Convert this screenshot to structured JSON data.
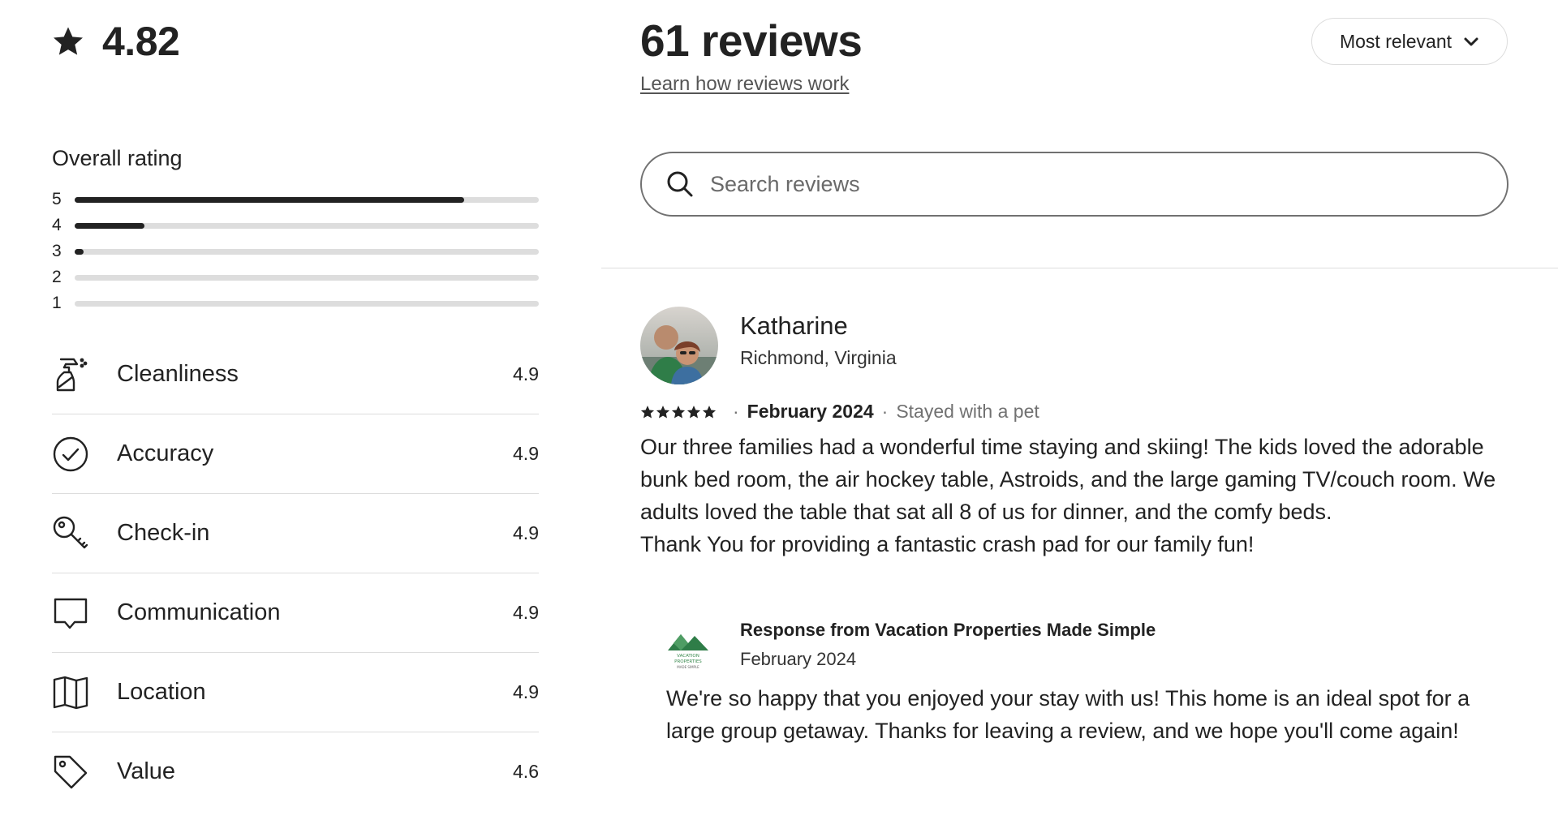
{
  "summary": {
    "overall_score": "4.82",
    "overall_rating_label": "Overall rating",
    "distribution": [
      {
        "label": "5",
        "fraction": 0.84
      },
      {
        "label": "4",
        "fraction": 0.15
      },
      {
        "label": "3",
        "fraction": 0.02
      },
      {
        "label": "2",
        "fraction": 0.0
      },
      {
        "label": "1",
        "fraction": 0.0
      }
    ],
    "categories": [
      {
        "name": "Cleanliness",
        "value": "4.9",
        "icon": "spray-bottle-icon"
      },
      {
        "name": "Accuracy",
        "value": "4.9",
        "icon": "check-circle-icon"
      },
      {
        "name": "Check-in",
        "value": "4.9",
        "icon": "key-icon"
      },
      {
        "name": "Communication",
        "value": "4.9",
        "icon": "chat-bubble-icon"
      },
      {
        "name": "Location",
        "value": "4.9",
        "icon": "map-icon"
      },
      {
        "name": "Value",
        "value": "4.6",
        "icon": "price-tag-icon"
      }
    ]
  },
  "reviews_header": {
    "count_label": "61 reviews",
    "learn_link": "Learn how reviews work",
    "sort_label": "Most relevant"
  },
  "search": {
    "placeholder": "Search reviews",
    "value": ""
  },
  "review": {
    "name": "Katharine",
    "location": "Richmond, Virginia",
    "rating": 5,
    "date": "February 2024",
    "stay_note": "Stayed with a pet",
    "paragraphs": [
      "Our three families had a wonderful time staying and skiing! The kids loved the adorable bunk bed room, the air hockey table, Astroids, and the large gaming TV/couch room. We adults loved the table that sat all 8 of us for dinner, and the comfy beds.",
      "Thank You for providing a fantastic crash pad for our family fun!"
    ],
    "response": {
      "from": "Response from Vacation Properties Made Simple",
      "date": "February 2024",
      "text": "We're so happy that you enjoyed your stay with us! This home is an ideal spot for a large group getaway. Thanks for leaving a review, and we hope you'll come again!",
      "logo_text": [
        "VACATION",
        "PROPERTIES",
        "MADE SIMPLE"
      ]
    }
  },
  "colors": {
    "text": "#222222",
    "muted": "#717171",
    "border": "#dddddd",
    "logo_green": "#3a8a4f"
  }
}
